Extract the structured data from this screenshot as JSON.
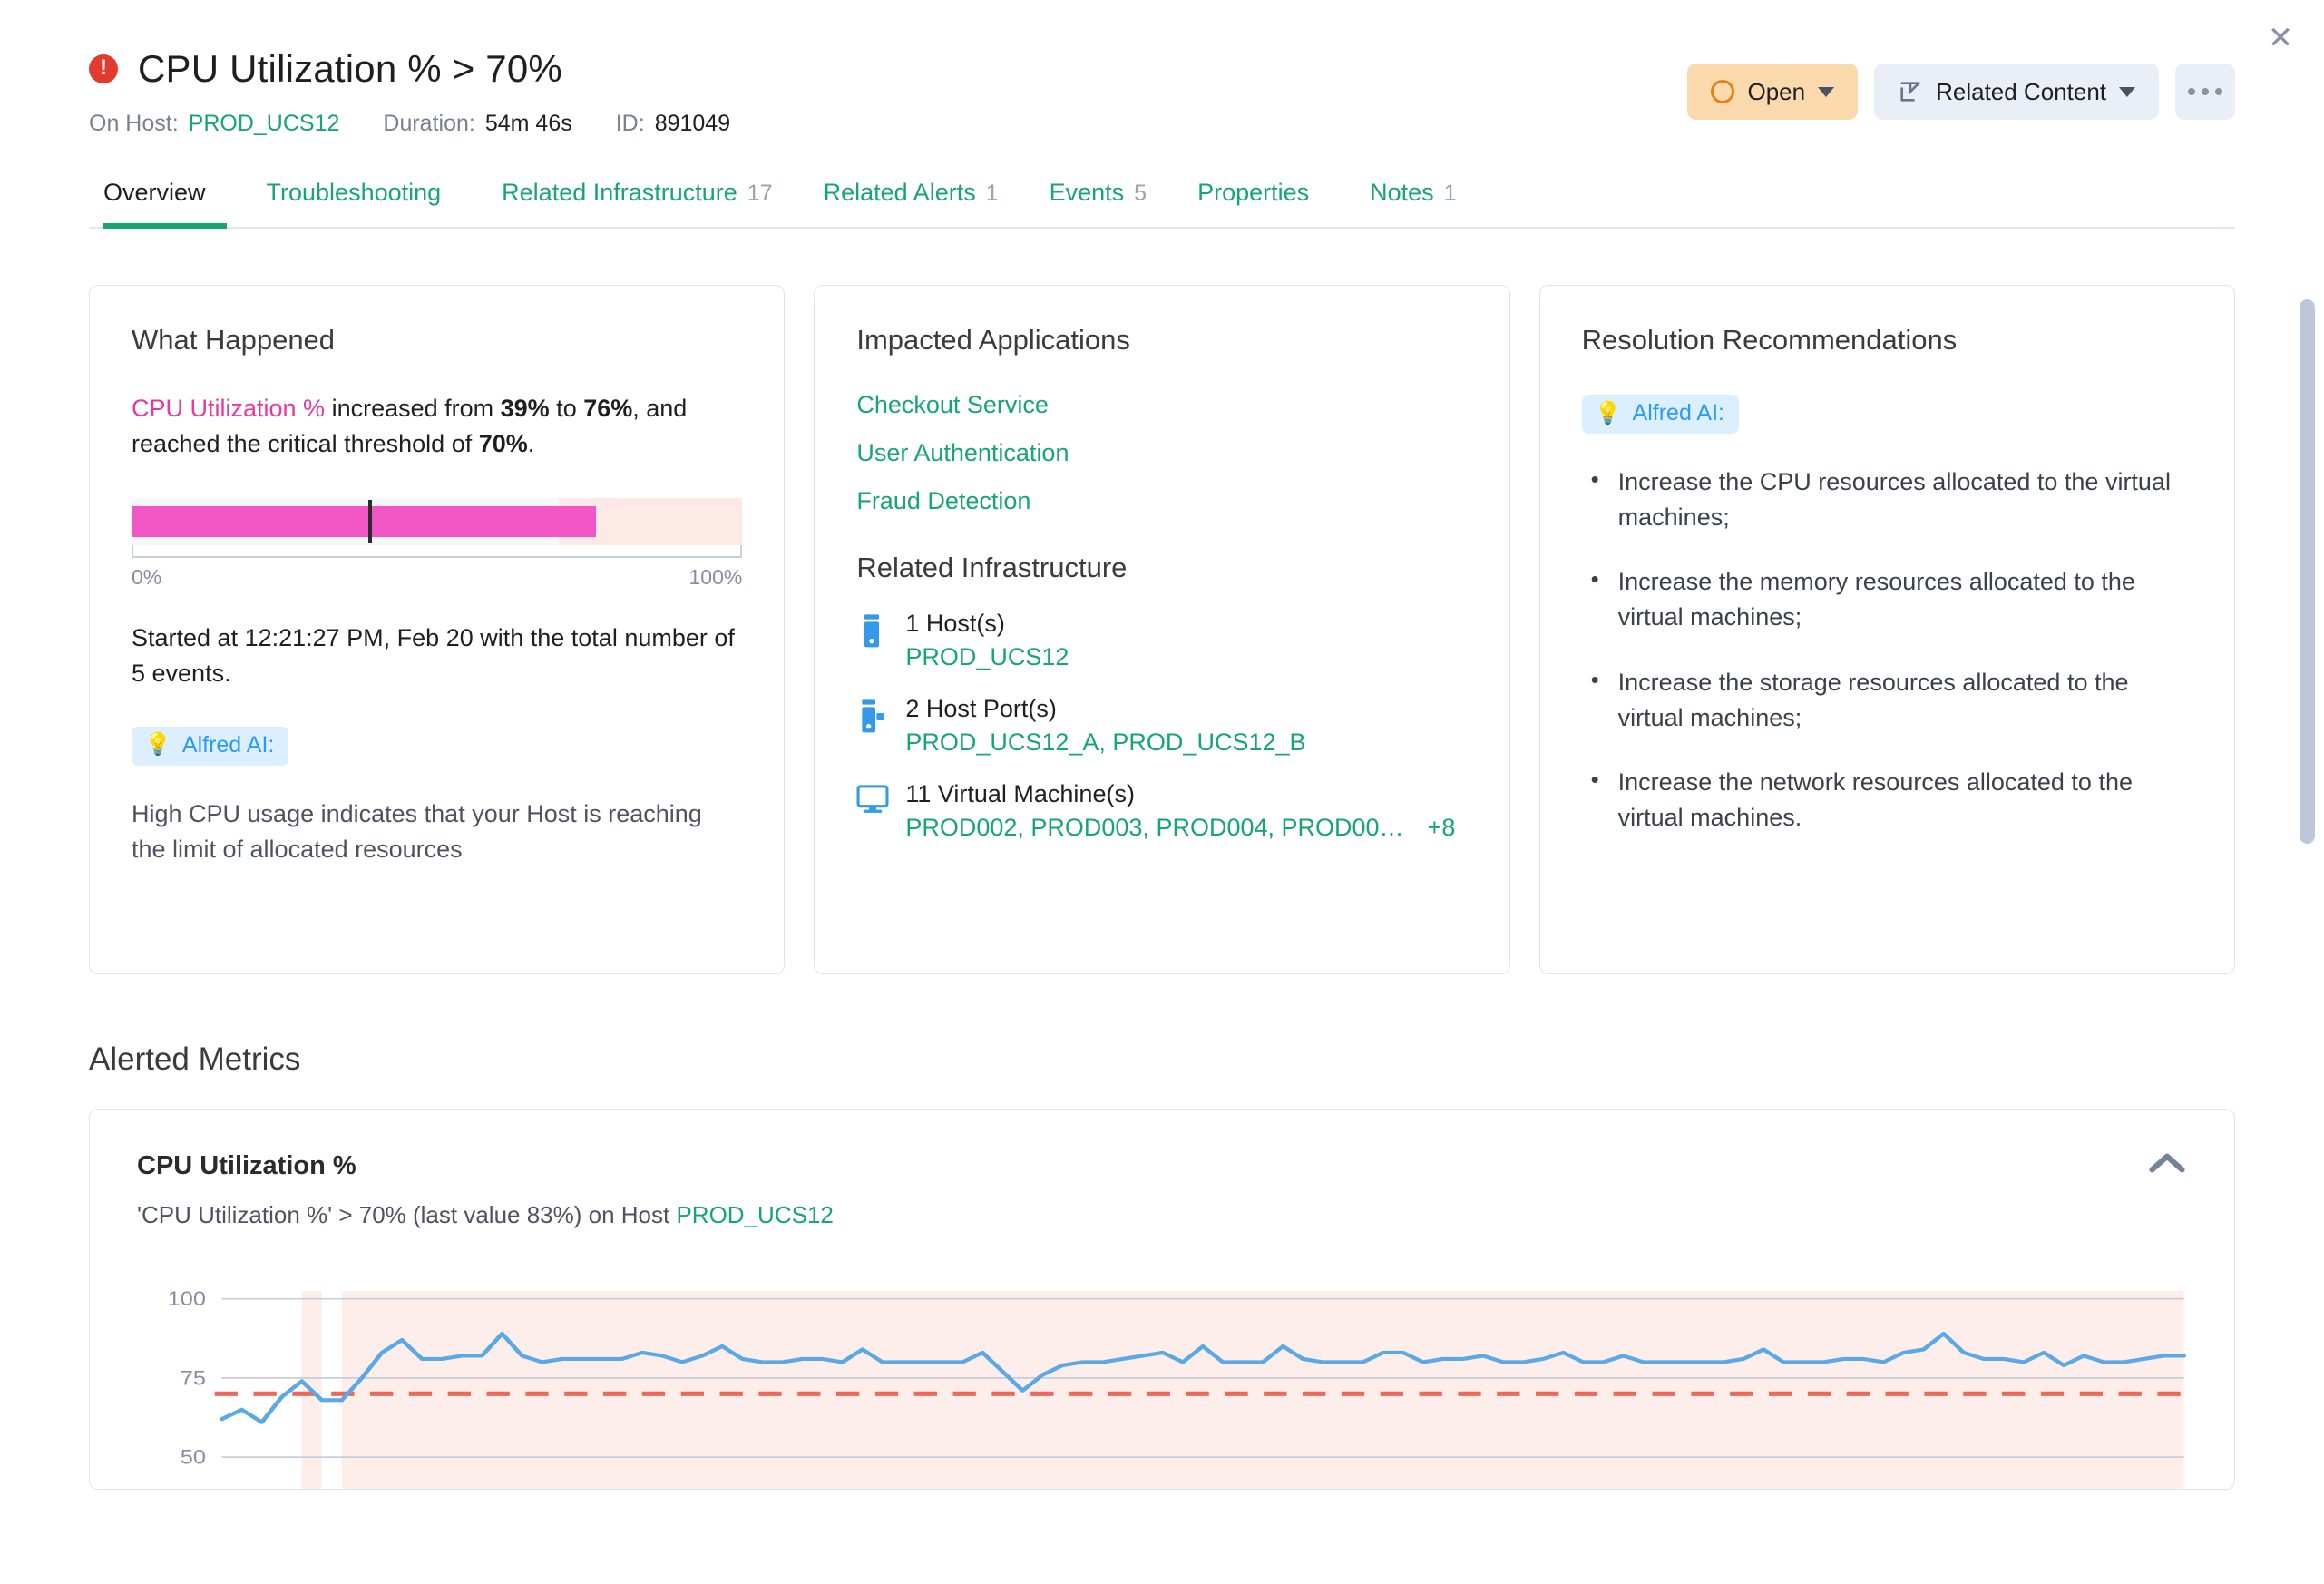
{
  "header": {
    "alert_icon": "alert-circle-icon",
    "title": "CPU Utilization % > 70%",
    "close_label": "✕",
    "meta": {
      "host_label": "On Host:",
      "host_value": "PROD_UCS12",
      "duration_label": "Duration:",
      "duration_value": "54m 46s",
      "id_label": "ID:",
      "id_value": "891049"
    },
    "actions": {
      "status_label": "Open",
      "related_label": "Related Content",
      "more_label": "…"
    }
  },
  "tabs": [
    {
      "label": "Overview",
      "count": "",
      "active": true
    },
    {
      "label": "Troubleshooting",
      "count": "",
      "active": false
    },
    {
      "label": "Related Infrastructure",
      "count": "17",
      "active": false
    },
    {
      "label": "Related Alerts",
      "count": "1",
      "active": false
    },
    {
      "label": "Events",
      "count": "5",
      "active": false
    },
    {
      "label": "Properties",
      "count": "",
      "active": false
    },
    {
      "label": "Notes",
      "count": "1",
      "active": false
    }
  ],
  "what_happened": {
    "title": "What Happened",
    "metric_name": "CPU Utilization %",
    "sentence_mid": " increased from ",
    "from_value": "39%",
    "to_connector": " to ",
    "to_value": "76%",
    "sentence_end": ", and reached the critical threshold of ",
    "threshold_value": "70%",
    "period": ".",
    "gauge": {
      "min_label": "0%",
      "max_label": "100%",
      "fill_percent": 76,
      "marker_percent": 39,
      "critical_percent": 70
    },
    "started_text": "Started at 12:21:27 PM, Feb 20 with the total number of 5 events.",
    "ai_badge": "Alfred AI:",
    "ai_text": "High CPU usage indicates that your Host is reaching the limit of allocated resources"
  },
  "impacted": {
    "title": "Impacted Applications",
    "apps": [
      "Checkout Service",
      "User Authentication",
      "Fraud Detection"
    ],
    "infra_title": "Related Infrastructure",
    "items": [
      {
        "icon": "server-icon",
        "count_label": "1 Host(s)",
        "names": "PROD_UCS12",
        "more": ""
      },
      {
        "icon": "server-port-icon",
        "count_label": "2 Host Port(s)",
        "names": "PROD_UCS12_A, PROD_UCS12_B",
        "more": ""
      },
      {
        "icon": "monitor-icon",
        "count_label": "11 Virtual Machine(s)",
        "names": "PROD002, PROD003, PROD004, PROD00…",
        "more": "+8"
      }
    ]
  },
  "resolution": {
    "title": "Resolution Recommendations",
    "ai_badge": "Alfred AI:",
    "items": [
      "Increase the CPU resources allocated to the virtual machines;",
      "Increase the memory resources allocated to the virtual machines;",
      "Increase the storage resources allocated to the virtual machines;",
      "Increase the network resources allocated to the virtual machines."
    ]
  },
  "alerted_metrics": {
    "section_title": "Alerted Metrics",
    "metric_title": "CPU Utilization %",
    "subtitle_pre": "'CPU Utilization %' > 70% (last value 83%) on Host ",
    "subtitle_host": "PROD_UCS12",
    "collapse_icon": "chevron-up-icon"
  },
  "colors": {
    "accent_green": "#17a673",
    "alert_red": "#e33a2e",
    "metric_pink": "#e8389f",
    "bar_pink": "#f156c4",
    "line_blue": "#5aa9e6",
    "threshold_red": "#f0675a",
    "status_amber": "#fad9ad"
  },
  "chart_data": {
    "type": "line",
    "title": "CPU Utilization %",
    "xlabel": "",
    "ylabel": "",
    "ylim": [
      40,
      102
    ],
    "yticks": [
      50,
      75,
      100
    ],
    "ytick_labels": [
      "50",
      "75",
      "100"
    ],
    "grid": true,
    "legend": false,
    "threshold": {
      "value": 70,
      "style": "dashed",
      "color": "#f0675a",
      "label": "70%"
    },
    "alert_regions": [
      {
        "start_index": 4,
        "end_index": 5
      },
      {
        "start_index": 6,
        "end_index": 98
      }
    ],
    "series": [
      {
        "name": "CPU Utilization %",
        "color": "#5aa9e6",
        "values": [
          62,
          65,
          61,
          69,
          74,
          68,
          68,
          75,
          83,
          87,
          81,
          81,
          82,
          82,
          89,
          82,
          80,
          81,
          81,
          81,
          81,
          83,
          82,
          80,
          82,
          85,
          81,
          80,
          80,
          81,
          81,
          80,
          84,
          80,
          80,
          80,
          80,
          80,
          83,
          77,
          71,
          76,
          79,
          80,
          80,
          81,
          82,
          83,
          80,
          85,
          80,
          80,
          80,
          85,
          81,
          80,
          80,
          80,
          83,
          83,
          80,
          81,
          81,
          82,
          80,
          80,
          81,
          83,
          80,
          80,
          82,
          80,
          80,
          80,
          80,
          80,
          81,
          84,
          80,
          80,
          80,
          81,
          81,
          80,
          83,
          84,
          89,
          83,
          81,
          81,
          80,
          83,
          79,
          82,
          80,
          80,
          81,
          82,
          82
        ]
      }
    ]
  }
}
